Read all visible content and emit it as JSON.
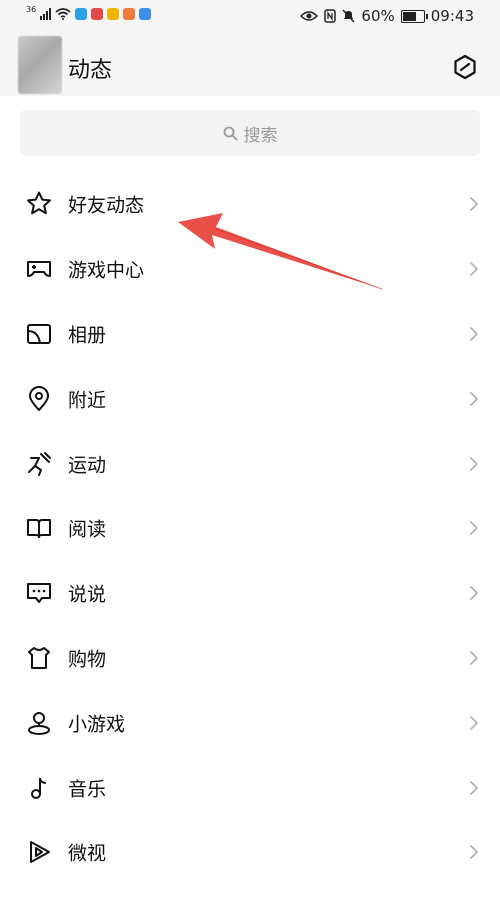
{
  "status_bar": {
    "network": "36",
    "battery": "60%",
    "time": "09:43",
    "app_icons": [
      {
        "name": "search-app-icon",
        "color": "#2aa0e6"
      },
      {
        "name": "red-app-icon",
        "color": "#e24a4a"
      },
      {
        "name": "yellow-app-icon",
        "color": "#f0b400"
      },
      {
        "name": "orange-app-icon",
        "color": "#f07a3a"
      },
      {
        "name": "cloud-app-icon",
        "color": "#3b8fe8"
      }
    ]
  },
  "header": {
    "title": "动态"
  },
  "search": {
    "placeholder": "搜索"
  },
  "menu": [
    {
      "label": "好友动态",
      "icon": "star-icon"
    },
    {
      "label": "游戏中心",
      "icon": "gamepad-icon"
    },
    {
      "label": "相册",
      "icon": "album-icon"
    },
    {
      "label": "附近",
      "icon": "location-pin-icon"
    },
    {
      "label": "运动",
      "icon": "running-icon"
    },
    {
      "label": "阅读",
      "icon": "book-icon"
    },
    {
      "label": "说说",
      "icon": "chat-bubble-icon"
    },
    {
      "label": "购物",
      "icon": "shopping-bag-icon"
    },
    {
      "label": "小游戏",
      "icon": "mini-game-icon"
    },
    {
      "label": "音乐",
      "icon": "music-note-icon"
    },
    {
      "label": "微视",
      "icon": "play-icon"
    }
  ],
  "annotation": {
    "arrow_color": "#e8413a"
  }
}
